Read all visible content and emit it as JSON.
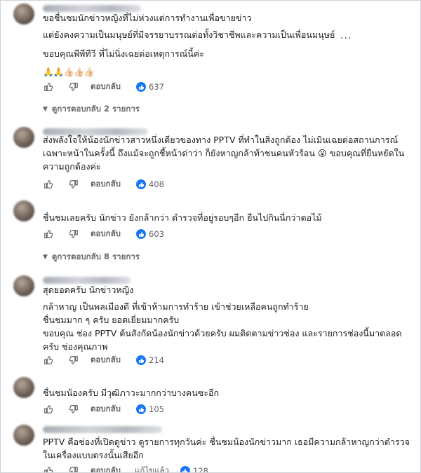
{
  "comments": [
    {
      "lines": [
        "ขอชื่นชมนักข่าวหญิงที่ไม่ห่วงแต่การทำงานเพื่อขายข่าว",
        "แต่ยังคงความเป็นมนุษย์ที่มีจรรยาบรรณต่อทั้งวิชาชีพและความเป็นเพื่อนมนุษย์",
        "ขอบคุณพีพีทีวี ที่ไม่นิ่งเฉยต่อเหตุการณ์นี้ค่ะ"
      ],
      "more": "...",
      "emojis": "🙏🙏👍🏻👍🏻👍🏻",
      "reply_label": "ตอบกลับ",
      "likes": "637"
    },
    {
      "lines": [
        "ส่งพลังใจให้น้องนักข่าวสาวหนึ่งเดียวของทาง PPTV ที่ทำในสิ่งถูกต้อง ไม่เมินเฉยต่อสถานการณ์",
        "เฉพาะหน้าในครั้งนี้ ถึงแม้จะถูกชี้หน้าด่าว่า ก็ยังหาญกล้าท้าชนคนหัวร้อน 😮 ขอบคุณที่ยืนหยัดใน",
        "ความถูกต้องค่ะ"
      ],
      "reply_label": "ตอบกลับ",
      "likes": "408"
    },
    {
      "lines": [
        "ชื่นชมเลยครับ นักข่าว ยังกล้ากว่า ตำรวจที่อยู่รอบๆอีก ยืนไปกินนี่กว่าตอไม้"
      ],
      "reply_label": "ตอบกลับ",
      "likes": "603"
    },
    {
      "lines": [
        "สุดยอดครับ นักข่าวหญิง",
        "กล้าหาญ เป็นพลเมืองดี ที่เข้าห้ามการทำร้าย เข้าช่วยเหลือคนถูกทำร้าย",
        "ชื่นชมมาก ๆ ครับ ยอดเยี่ยมมากครับ",
        "ขอบคุณ ช่อง PPTV ต้นสังกัดน้องนักข่าวด้วยครับ ผมติดตามข่าวช่อง และรายการช่องนี้มาตลอด",
        "ครับ ช่องคุณภาพ"
      ],
      "reply_label": "ตอบกลับ",
      "likes": "214"
    },
    {
      "lines": [
        "ชื่นชมน้องครับ มีวุฒิภาวะมากกว่าบางคนซะอีก"
      ],
      "reply_label": "ตอบกลับ",
      "likes": "105"
    },
    {
      "lines": [
        "PPTV คือช่องที่เปิดดูข่าว ดูรายการทุกวันค่ะ ชื่นชมน้องนักข่าวมาก เธอมีความกล้าหาญกว่าตำรวจ",
        "ในเครื่องแบบตรงนั้นเสียอีก"
      ],
      "reply_label": "ตอบกลับ",
      "edit_label": "แก้ไขแล้ว",
      "likes": "128"
    }
  ],
  "view_replies": [
    "ดูการตอบกลับ 2 รายการ",
    "ดูการตอบกลับ 8 รายการ"
  ],
  "colors": {
    "like_blue": "#1877f2",
    "meta_gray": "#65676b"
  },
  "icons": [
    "like-icon",
    "dislike-icon",
    "reaction-like-icon",
    "chevron-down-icon"
  ]
}
